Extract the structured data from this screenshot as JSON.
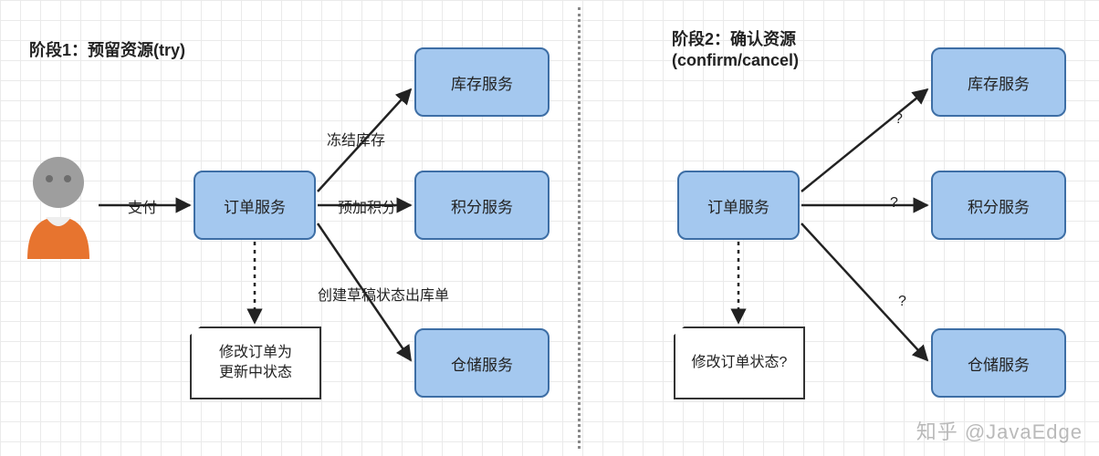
{
  "phase1": {
    "title": "阶段1：预留资源(try)",
    "nodes": {
      "order": "订单服务",
      "inventory": "库存服务",
      "points": "积分服务",
      "warehouse": "仓储服务"
    },
    "edges": {
      "pay": "支付",
      "freeze_inventory": "冻结库存",
      "pre_add_points": "预加积分",
      "create_draft_outbound": "创建草稿状态出库单"
    },
    "note": "修改订单为\n更新中状态"
  },
  "phase2": {
    "title": "阶段2：确认资源\n(confirm/cancel)",
    "nodes": {
      "order": "订单服务",
      "inventory": "库存服务",
      "points": "积分服务",
      "warehouse": "仓储服务"
    },
    "edges": {
      "to_inventory": "?",
      "to_points": "?",
      "to_warehouse": "?"
    },
    "note": "修改订单状态?"
  },
  "watermark": "知乎 @JavaEdge",
  "colors": {
    "box_fill": "#a4c8ef",
    "box_border": "#3d6ea5",
    "user_head": "#9e9e9e",
    "user_body": "#e7742f"
  }
}
